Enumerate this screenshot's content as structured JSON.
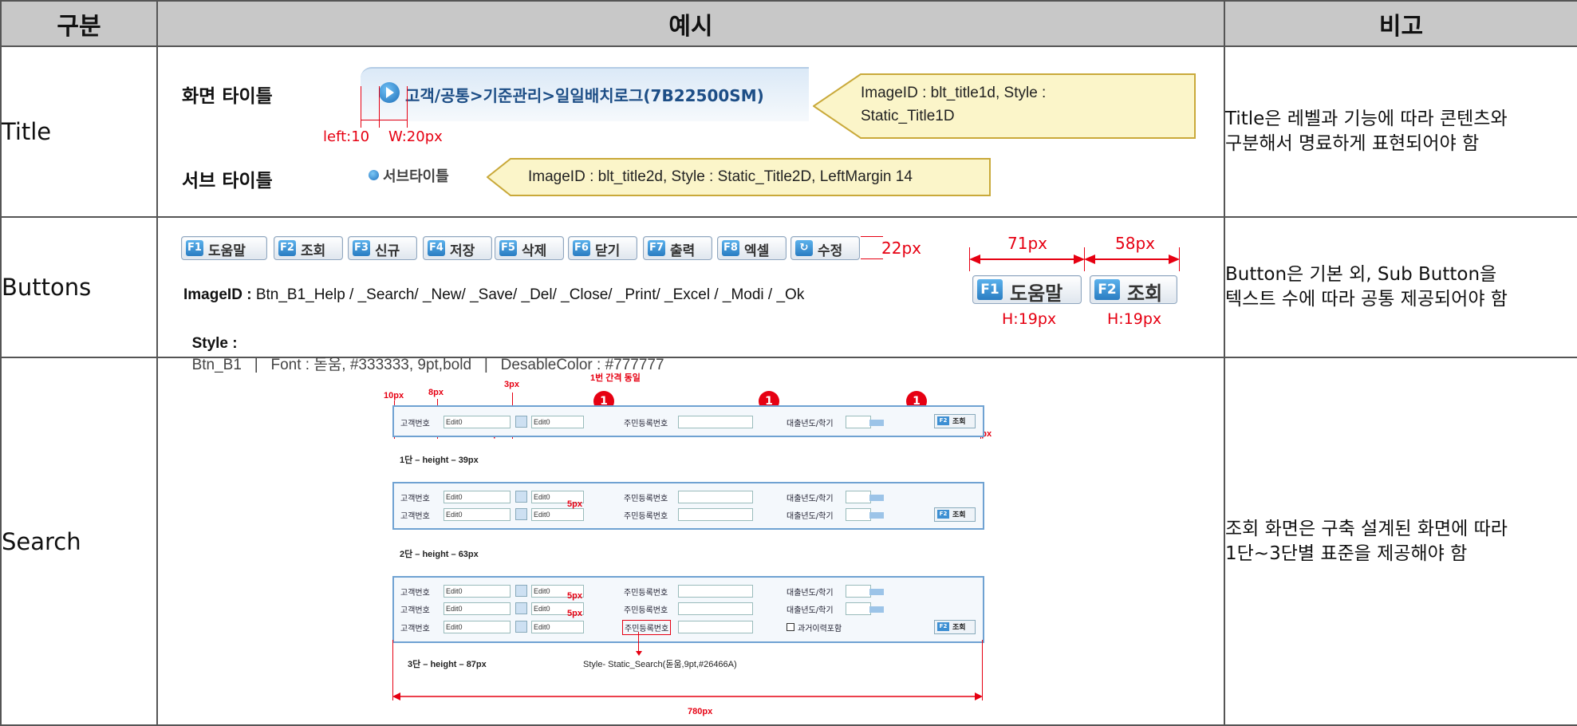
{
  "header": {
    "col1": "구분",
    "col2": "예시",
    "col3": "비고"
  },
  "rows": {
    "title": {
      "label": "Title",
      "note_lines": [
        "Title은 레벨과 기능에 따라 콘텐츠와",
        "구분해서 명료하게 표현되어야 함"
      ],
      "screen_title_label": "화면 타이틀",
      "screen_title_sample": "고객/공통>기준관리>일일배치로그(7B22500SM)",
      "callout1": [
        "ImageID : blt_title1d, Style :",
        "Static_Title1D"
      ],
      "dim_left": "left:10",
      "dim_width": "W:20px",
      "sub_title_label": "서브 타이틀",
      "sub_title_sample": "서브타이틀",
      "callout2": "ImageID : blt_title2d, Style : Static_Title2D, LeftMargin 14"
    },
    "buttons": {
      "label": "Buttons",
      "note_lines": [
        "Button은 기본 외, Sub Button을",
        "텍스트 수에 따라 공통 제공되어야 함"
      ],
      "items": [
        {
          "key": "F1",
          "label": "도움말"
        },
        {
          "key": "F2",
          "label": "조회"
        },
        {
          "key": "F3",
          "label": "신규"
        },
        {
          "key": "F4",
          "label": "저장"
        },
        {
          "key": "F5",
          "label": "삭제"
        },
        {
          "key": "F6",
          "label": "닫기"
        },
        {
          "key": "F7",
          "label": "출력"
        },
        {
          "key": "F8",
          "label": "엑셀"
        },
        {
          "key": "↻",
          "label": "수정"
        }
      ],
      "height_anno": "22px",
      "image_id_prefix": "ImageID :",
      "image_id_text": "Btn_B1_Help / _Search/ _New/  _Save/  _Del/  _Close/  _Print/  _Excel / _Modi / _Ok",
      "style_prefix": "Style :",
      "style_text": "Btn_B1   |   Font : 돋움, #333333, 9pt,bold   |   DesableColor : #777777",
      "sample1_key": "F1",
      "sample1_label": "도움말",
      "sample2_key": "F2",
      "sample2_label": "조회",
      "width1": "71px",
      "width2": "58px",
      "height1": "H:19px",
      "height2": "H:19px"
    },
    "search": {
      "label": "Search",
      "note_lines": [
        "조회 화면은 구축 설계된 화면에 따라",
        "1단~3단별 표준을 제공해야 함"
      ],
      "field_customer": "고객번호",
      "field_rrn": "주민등록번호",
      "field_year": "대출년도/학기",
      "edit_value": "Edit0",
      "search_key": "F2",
      "search_btn": "조회",
      "checkbox_label": "과거이력포함",
      "cap1": "1단 – height – 39px",
      "cap2": "2단 – height – 63px",
      "cap3": "3단 – height – 87px",
      "style_note": "Style- Static_Search(돋움,9pt,#26466A)",
      "same_gap": "1번 간격 동일",
      "marker": "1",
      "anno_10": "10px",
      "anno_8": "8px",
      "anno_3": "3px",
      "anno_5": "5px",
      "anno_total": "780px"
    }
  },
  "colors": {
    "header_bg": "#c8c8c8",
    "accent_red": "#e60012",
    "callout_bg": "#fbf5c9",
    "panel_border": "#6fa2d2"
  }
}
